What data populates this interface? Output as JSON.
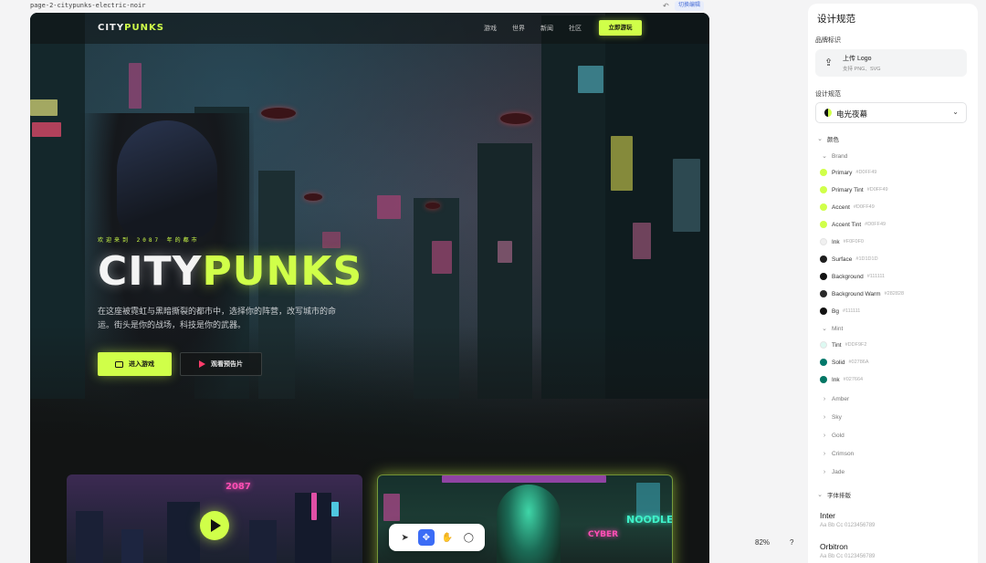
{
  "topbar": {
    "filename": "page-2-citypunks-electric-noir",
    "switch_edit": "切换编辑"
  },
  "site": {
    "logo_pre": "CITY",
    "logo_hl": "PUNKS",
    "nav": [
      "游戏",
      "世界",
      "新闻",
      "社区"
    ],
    "nav_cta": "立即游玩",
    "eyebrow": "欢迎来到 2087 年的都市",
    "title_pre": "CITY",
    "title_hl": "PUNKS",
    "desc": "在这座被霓虹与黑暗撕裂的都市中，选择你的阵营，改写城市的命运。街头是你的战场，科技是你的武器。",
    "btn_primary": "进入游戏",
    "btn_secondary": "观看预告片",
    "card1_sign": "2087",
    "card2_sign1": "CYBER",
    "card2_sign2": "NOODLE"
  },
  "canvas": {
    "zoom": "82%",
    "help": "?"
  },
  "panel": {
    "title": "设计规范",
    "brand_label": "品牌标识",
    "upload_title": "上传 Logo",
    "upload_sub": "支持 PNG、SVG",
    "spec_label": "设计规范",
    "spec_value": "电光夜幕",
    "colors_label": "颜色",
    "brand_group": "Brand",
    "brand_colors": [
      {
        "name": "Primary",
        "hex": "#D0FF49",
        "color": "#D0FF49"
      },
      {
        "name": "Primary Tint",
        "hex": "#D0FF49",
        "color": "#D0FF49"
      },
      {
        "name": "Accent",
        "hex": "#D0FF49",
        "color": "#D0FF49"
      },
      {
        "name": "Accent Tint",
        "hex": "#D0FF49",
        "color": "#D0FF49"
      },
      {
        "name": "Ink",
        "hex": "#F0F0F0",
        "color": "#F0F0F0"
      },
      {
        "name": "Surface",
        "hex": "#1D1D1D",
        "color": "#1D1D1D"
      },
      {
        "name": "Background",
        "hex": "#111111",
        "color": "#111111"
      },
      {
        "name": "Background Warm",
        "hex": "#282828",
        "color": "#282828"
      },
      {
        "name": "Bg",
        "hex": "#111111",
        "color": "#111111"
      }
    ],
    "mint_group": "Mint",
    "mint_colors": [
      {
        "name": "Tint",
        "hex": "#DDF9F2",
        "color": "#DDF9F2"
      },
      {
        "name": "Solid",
        "hex": "#02786A",
        "color": "#02786A"
      },
      {
        "name": "Ink",
        "hex": "#027664",
        "color": "#027664"
      }
    ],
    "collapsed_groups": [
      "Amber",
      "Sky",
      "Gold",
      "Crimson",
      "Jade"
    ],
    "typography_label": "字体排版",
    "fonts": [
      {
        "name": "Inter",
        "sample": "Aa Bb Cc 0123456789"
      },
      {
        "name": "Orbitron",
        "sample": "Aa Bb Cc 0123456789"
      }
    ]
  }
}
